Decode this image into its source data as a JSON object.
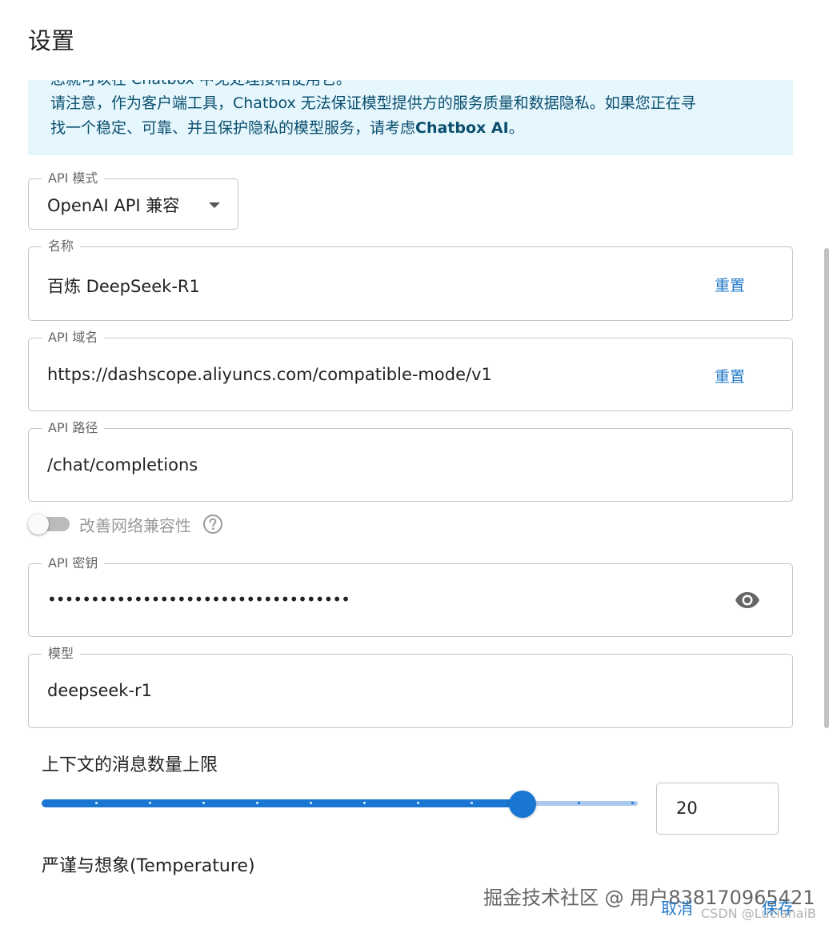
{
  "dialog": {
    "title": "设置"
  },
  "notice": {
    "line0": "您就可以在 Chatbox 中免处理接相使用它。",
    "line1": "请注意，作为客户端工具，Chatbox 无法保证模型提供方的服务质量和数据隐私。如果您正在寻",
    "line2_prefix": "找一个稳定、可靠、并且保护隐私的模型服务，请考虑",
    "line2_bold": "Chatbox AI",
    "line2_suffix": "。"
  },
  "api_mode": {
    "label": "API 模式",
    "value": "OpenAI API 兼容"
  },
  "name_field": {
    "label": "名称",
    "value": "百炼 DeepSeek-R1",
    "reset_label": "重置"
  },
  "domain_field": {
    "label": "API 域名",
    "value": "https://dashscope.aliyuncs.com/compatible-mode/v1",
    "reset_label": "重置"
  },
  "path_field": {
    "label": "API 路径",
    "value": "/chat/completions"
  },
  "compat_toggle": {
    "label": "改善网络兼容性",
    "enabled": false
  },
  "key_field": {
    "label": "API 密钥",
    "value": "•••••••••••••••••••••••••••••••••••",
    "icon": "eye-icon"
  },
  "model_field": {
    "label": "模型",
    "value": "deepseek-r1"
  },
  "context_limit": {
    "title": "上下文的消息数量上限",
    "value": "20",
    "slider_fraction": 0.905,
    "mark_count": 12
  },
  "temperature": {
    "title": "严谨与想象(Temperature)"
  },
  "footer": {
    "cancel_label": "取消",
    "save_label": "保存"
  },
  "watermark": {
    "main": "掘金技术社区 @ 用户838170965421",
    "csdn": "CSDN @LucianaiB"
  },
  "colors": {
    "accent": "#1976d2",
    "notice_bg": "#e5f6fd",
    "notice_text": "#0a4f6e",
    "link": "#1f78c8"
  }
}
